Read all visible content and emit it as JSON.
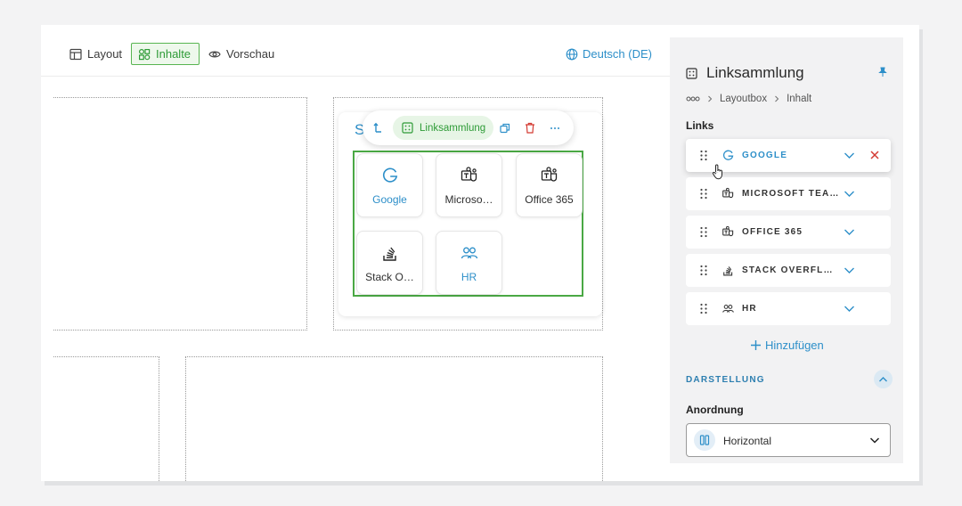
{
  "toolbar": {
    "tabs": [
      {
        "label": "Layout",
        "icon": "layout-icon"
      },
      {
        "label": "Inhalte",
        "icon": "content-icon",
        "active": true
      },
      {
        "label": "Vorschau",
        "icon": "eye-icon"
      }
    ],
    "language": "Deutsch (DE)"
  },
  "canvas": {
    "card_letter": "S",
    "widget_toolbar": {
      "label": "Linksammlung"
    },
    "tiles": [
      {
        "label": "Google",
        "icon": "google-icon"
      },
      {
        "label": "Microso…",
        "icon": "teams-icon"
      },
      {
        "label": "Office 365",
        "icon": "teams-icon"
      },
      {
        "label": "Stack O…",
        "icon": "stackoverflow-icon"
      },
      {
        "label": "HR",
        "icon": "people-icon"
      }
    ]
  },
  "panel": {
    "title": "Linksammlung",
    "breadcrumb": [
      "Layoutbox",
      "Inhalt"
    ],
    "links_heading": "Links",
    "links": [
      {
        "label": "GOOGLE",
        "icon": "google-icon",
        "active": true
      },
      {
        "label": "MICROSOFT TEA…",
        "icon": "teams-icon"
      },
      {
        "label": "OFFICE 365",
        "icon": "teams-icon"
      },
      {
        "label": "STACK OVERFLOW",
        "icon": "stackoverflow-icon"
      },
      {
        "label": "HR",
        "icon": "people-icon"
      }
    ],
    "add_label": "Hinzufügen",
    "display_heading": "DARSTELLUNG",
    "arrangement_heading": "Anordnung",
    "arrangement_value": "Horizontal"
  },
  "colors": {
    "accent_blue": "#2d8fc9",
    "accent_green": "#2e9b37",
    "danger": "#d33a32"
  }
}
